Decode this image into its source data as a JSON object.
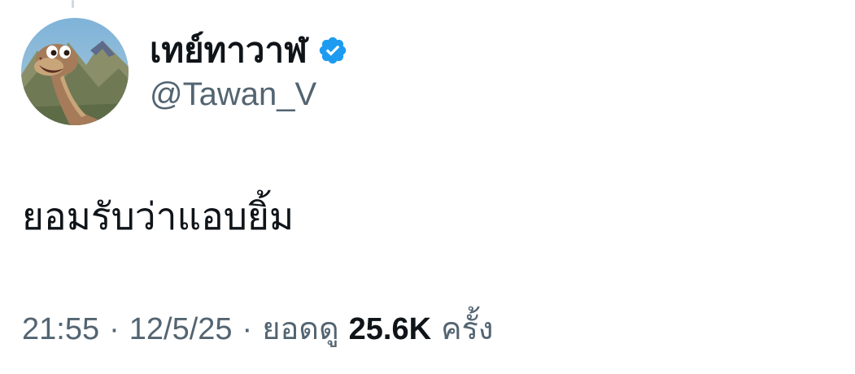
{
  "tweet": {
    "author": {
      "display_name": "เทย์ทาวาฬ",
      "handle": "@Tawan_V",
      "verified": true,
      "avatar_icon": "dinosaur-avatar"
    },
    "text": "ยอมรับว่าแอบยิ้ม",
    "meta": {
      "time": "21:55",
      "separator": "·",
      "date": "12/5/25",
      "views_label": "ยอดดู",
      "views_count": "25.6K",
      "views_suffix": "ครั้ง"
    }
  },
  "colors": {
    "text_primary": "#0f1419",
    "text_secondary": "#536471",
    "verified_blue": "#1d9bf0",
    "thread_line": "#cfd9de"
  }
}
